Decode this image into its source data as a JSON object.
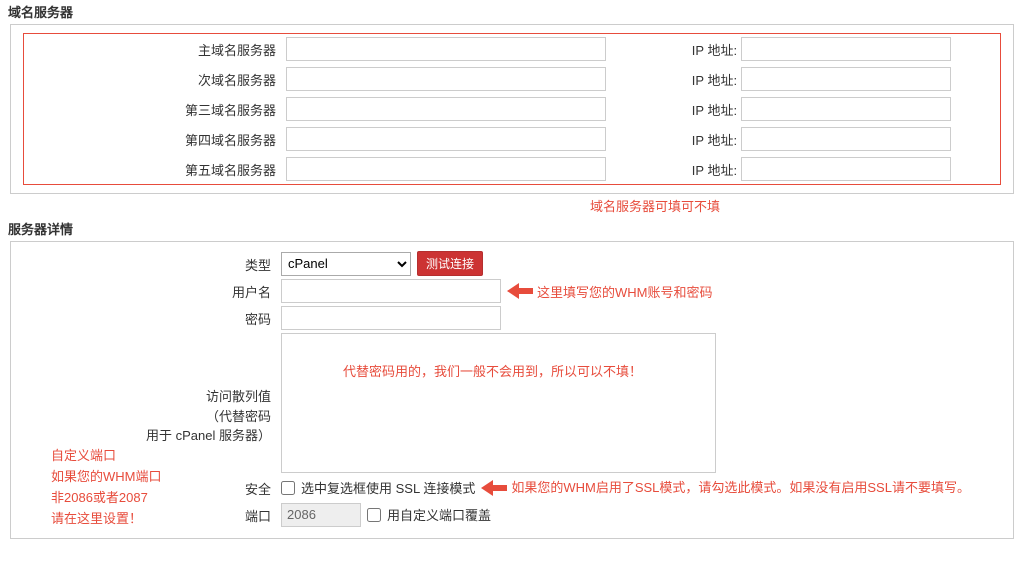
{
  "ns_section": {
    "title": "域名服务器",
    "rows": [
      {
        "label": "主域名服务器",
        "ip_label": "IP 地址:"
      },
      {
        "label": "次域名服务器",
        "ip_label": "IP 地址:"
      },
      {
        "label": "第三域名服务器",
        "ip_label": "IP 地址:"
      },
      {
        "label": "第四域名服务器",
        "ip_label": "IP 地址:"
      },
      {
        "label": "第五域名服务器",
        "ip_label": "IP 地址:"
      }
    ],
    "note": "域名服务器可填可不填"
  },
  "sd_section": {
    "title": "服务器详情",
    "type_label": "类型",
    "type_value": "cPanel",
    "test_btn": "测试连接",
    "user_label": "用户名",
    "user_annot": "这里填写您的WHM账号和密码",
    "pass_label": "密码",
    "hash_label_l1": "访问散列值",
    "hash_label_l2": "（代替密码",
    "hash_label_l3": "用于 cPanel 服务器）",
    "hash_annot": "代替密码用的，我们一般不会用到，所以可以不填！",
    "secure_label": "安全",
    "secure_cb_text": "选中复选框使用 SSL 连接模式",
    "secure_annot": "如果您的WHM启用了SSL模式，请勾选此模式。如果没有启用SSL请不要填写。",
    "port_label": "端口",
    "port_value": "2086",
    "port_cb_text": "用自定义端口覆盖",
    "port_annot_l1": "自定义端口",
    "port_annot_l2": "如果您的WHM端口",
    "port_annot_l3": "非2086或者2087",
    "port_annot_l4": "请在这里设置！"
  }
}
